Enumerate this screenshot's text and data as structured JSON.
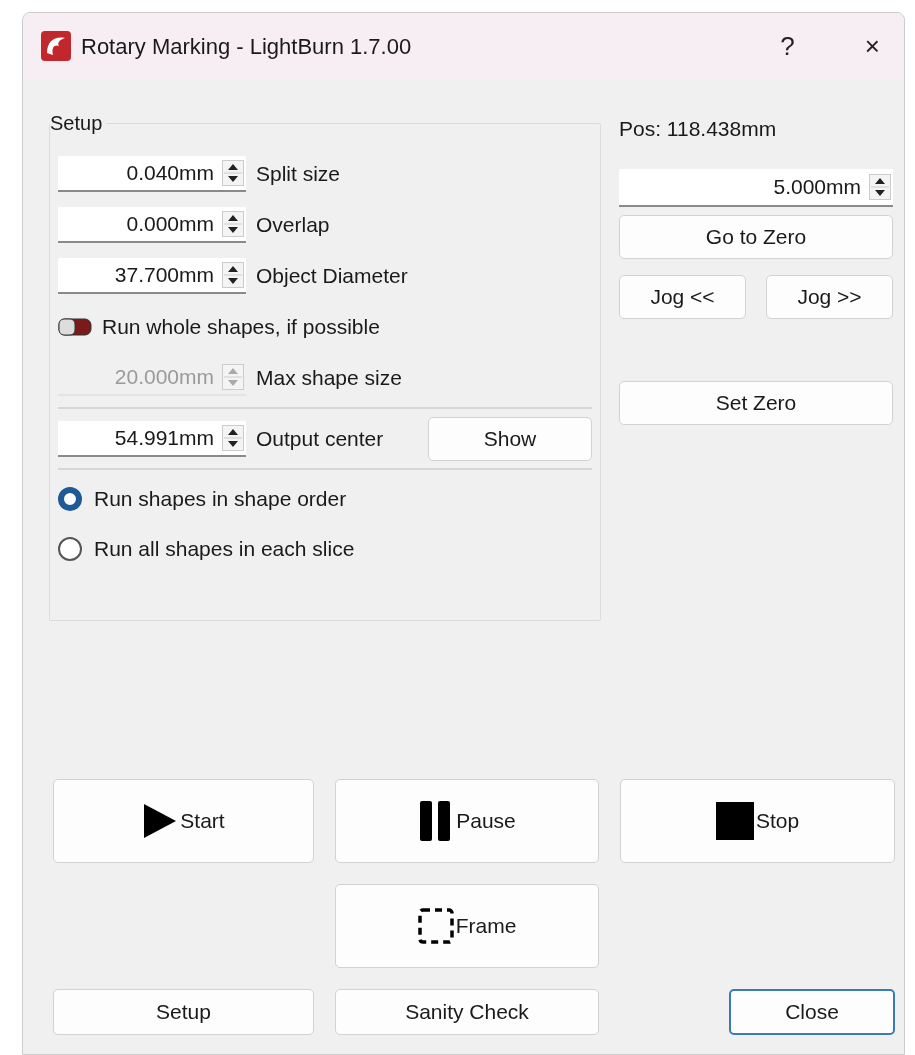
{
  "window": {
    "title": "Rotary Marking - LightBurn 1.7.00",
    "help_label": "?",
    "close_label": "×"
  },
  "setup": {
    "title": "Setup",
    "rows": [
      {
        "kind": "spin",
        "value": "0.040mm",
        "label": "Split size",
        "disabled": false
      },
      {
        "kind": "spin",
        "value": "0.000mm",
        "label": "Overlap",
        "disabled": false
      },
      {
        "kind": "spin",
        "value": "37.700mm",
        "label": "Object Diameter",
        "disabled": false
      },
      {
        "kind": "toggle",
        "label": "Run whole shapes, if possible",
        "on": false
      },
      {
        "kind": "spin",
        "value": "20.000mm",
        "label": "Max shape size",
        "disabled": true
      },
      {
        "kind": "divider"
      },
      {
        "kind": "spin",
        "value": "54.991mm",
        "label": "Output center",
        "disabled": false,
        "button": "Show"
      },
      {
        "kind": "divider"
      }
    ],
    "radios": [
      {
        "label": "Run shapes in shape order",
        "selected": true
      },
      {
        "label": "Run all shapes in each slice",
        "selected": false
      }
    ]
  },
  "position": {
    "label": "Pos: 118.438mm",
    "step": "5.000mm",
    "go_zero": "Go to Zero",
    "jog_back": "Jog <<",
    "jog_forward": "Jog >>",
    "set_zero": "Set Zero"
  },
  "actions": [
    {
      "kind": "start",
      "label": "Start"
    },
    {
      "kind": "pause",
      "label": "Pause"
    },
    {
      "kind": "stop",
      "label": "Stop"
    },
    {
      "kind": "frame",
      "label": "Frame"
    }
  ],
  "footer": [
    {
      "label": "Setup",
      "focused": false
    },
    {
      "label": "Sanity Check",
      "focused": false
    },
    {
      "label": "Close",
      "focused": true
    }
  ]
}
